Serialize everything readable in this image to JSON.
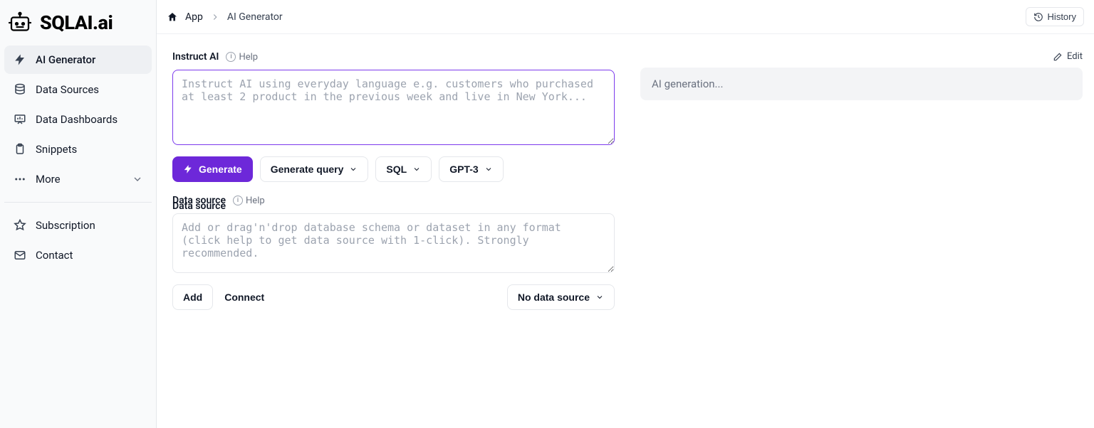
{
  "brand": {
    "name": "SQLAI.ai"
  },
  "sidebar": {
    "items": [
      {
        "label": "AI Generator"
      },
      {
        "label": "Data Sources"
      },
      {
        "label": "Data Dashboards"
      },
      {
        "label": "Snippets"
      },
      {
        "label": "More"
      }
    ],
    "footer": [
      {
        "label": "Subscription"
      },
      {
        "label": "Contact"
      }
    ]
  },
  "breadcrumb": {
    "root": "App",
    "current": "AI Generator"
  },
  "topbar": {
    "history": "History"
  },
  "instruct": {
    "label": "Instruct AI",
    "help": "Help",
    "placeholder": "Instruct AI using everyday language e.g. customers who purchased at least 2 product in the previous week and live in New York...",
    "value": ""
  },
  "actions": {
    "generate": "Generate",
    "generate_query": "Generate query",
    "language": "SQL",
    "model": "GPT-3"
  },
  "datasource": {
    "label": "Data source",
    "help": "Help",
    "placeholder": "Add or drag'n'drop database schema or dataset in any format (click help to get data source with 1-click). Strongly recommended.",
    "value": "",
    "add": "Add",
    "connect": "Connect",
    "selected": "No data source"
  },
  "right": {
    "edit": "Edit",
    "placeholder": "AI generation..."
  }
}
